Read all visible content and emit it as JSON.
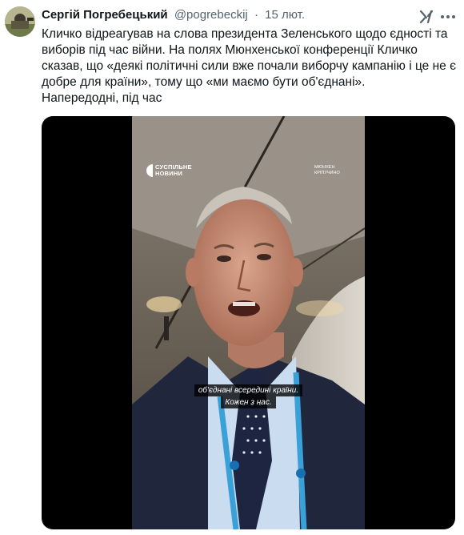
{
  "author": {
    "name": "Сергій Погребецький",
    "handle": "@pogrebeckij",
    "separator": "·",
    "time": "15 лют."
  },
  "icons": {
    "grok": "grok-icon",
    "more": "more-icon"
  },
  "tweet": {
    "text": "Кличко відреагував на слова президента Зеленського щодо єдності та виборів під час війни. На полях Мюнхенської конференції Кличко сказав, що «деякі політичні сили вже почали виборчу кампанію і це не є добре для країни», тому що «ми маємо бути об'єднані».\nНапередодні, під час"
  },
  "video": {
    "watermark_line1": "СУСПІЛЬНЕ",
    "watermark_line2": "НОВИНИ",
    "location_line1": "МЮНХЕН",
    "location_line2": "КРІПУЧИНО",
    "subtitle_line1": "об'єднані всередині країни.",
    "subtitle_line2": "Кожен з нас."
  },
  "colors": {
    "text": "#0f1419",
    "secondary": "#536471",
    "media_bg": "#000000"
  }
}
